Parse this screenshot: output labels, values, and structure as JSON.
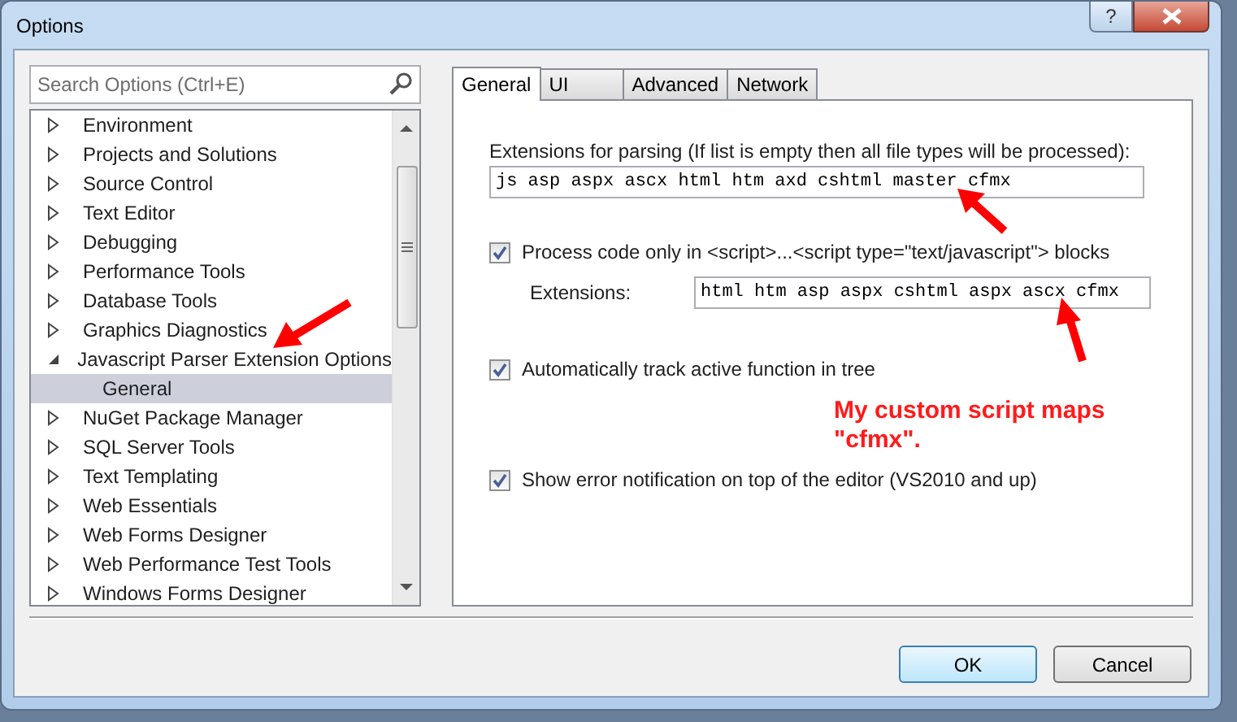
{
  "window": {
    "title": "Options",
    "help": "?"
  },
  "search": {
    "placeholder": "Search Options (Ctrl+E)"
  },
  "tree": [
    {
      "label": "Environment",
      "expanded": false,
      "selected": false
    },
    {
      "label": "Projects and Solutions",
      "expanded": false,
      "selected": false
    },
    {
      "label": "Source Control",
      "expanded": false,
      "selected": false
    },
    {
      "label": "Text Editor",
      "expanded": false,
      "selected": false
    },
    {
      "label": "Debugging",
      "expanded": false,
      "selected": false
    },
    {
      "label": "Performance Tools",
      "expanded": false,
      "selected": false
    },
    {
      "label": "Database Tools",
      "expanded": false,
      "selected": false
    },
    {
      "label": "Graphics Diagnostics",
      "expanded": false,
      "selected": false
    },
    {
      "label": "Javascript Parser Extension Options",
      "expanded": true,
      "selected": false,
      "children": [
        {
          "label": "General",
          "selected": true
        }
      ]
    },
    {
      "label": "NuGet Package Manager",
      "expanded": false,
      "selected": false
    },
    {
      "label": "SQL Server Tools",
      "expanded": false,
      "selected": false
    },
    {
      "label": "Text Templating",
      "expanded": false,
      "selected": false
    },
    {
      "label": "Web Essentials",
      "expanded": false,
      "selected": false
    },
    {
      "label": "Web Forms Designer",
      "expanded": false,
      "selected": false
    },
    {
      "label": "Web Performance Test Tools",
      "expanded": false,
      "selected": false
    },
    {
      "label": "Windows Forms Designer",
      "expanded": false,
      "selected": false
    }
  ],
  "tabs": [
    {
      "label": "General",
      "selected": true
    },
    {
      "label": "UI",
      "selected": false
    },
    {
      "label": "Advanced",
      "selected": false
    },
    {
      "label": "Network",
      "selected": false
    }
  ],
  "settings": [
    {
      "kind": "field",
      "label": "Extensions for parsing (If list is empty then all file types will be processed):",
      "value": "js asp aspx ascx html htm axd cshtml master cfmx"
    },
    {
      "kind": "checkbox",
      "label": "Process code only in <script>...<script type=\"text/javascript\"> blocks",
      "checked": true
    },
    {
      "kind": "subfield",
      "label": "Extensions:",
      "value": "html htm asp aspx cshtml aspx ascx cfmx"
    },
    {
      "kind": "checkbox",
      "label": "Automatically track active function in tree",
      "checked": true
    },
    {
      "kind": "checkbox",
      "label": "Show error notification on top of the editor (VS2010 and up)",
      "checked": true
    }
  ],
  "annotation": "My custom script maps \"cfmx\".",
  "buttons": [
    {
      "label": "OK",
      "default": true
    },
    {
      "label": "Cancel",
      "default": false
    }
  ]
}
